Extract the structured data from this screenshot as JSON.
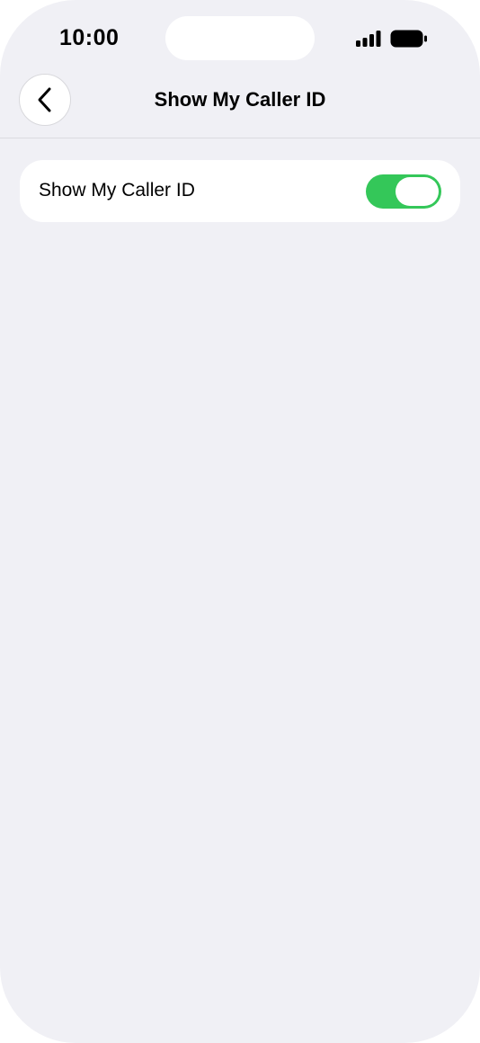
{
  "status_bar": {
    "time": "10:00",
    "signal_icon": "cellular-signal-icon",
    "battery_icon": "battery-full-icon"
  },
  "nav": {
    "back_icon": "chevron-left-icon",
    "title": "Show My Caller ID"
  },
  "settings": {
    "rows": [
      {
        "label": "Show My Caller ID",
        "toggle_on": true
      }
    ]
  },
  "colors": {
    "background": "#f0f0f5",
    "card": "#ffffff",
    "toggle_on": "#34c759",
    "text": "#000000"
  }
}
